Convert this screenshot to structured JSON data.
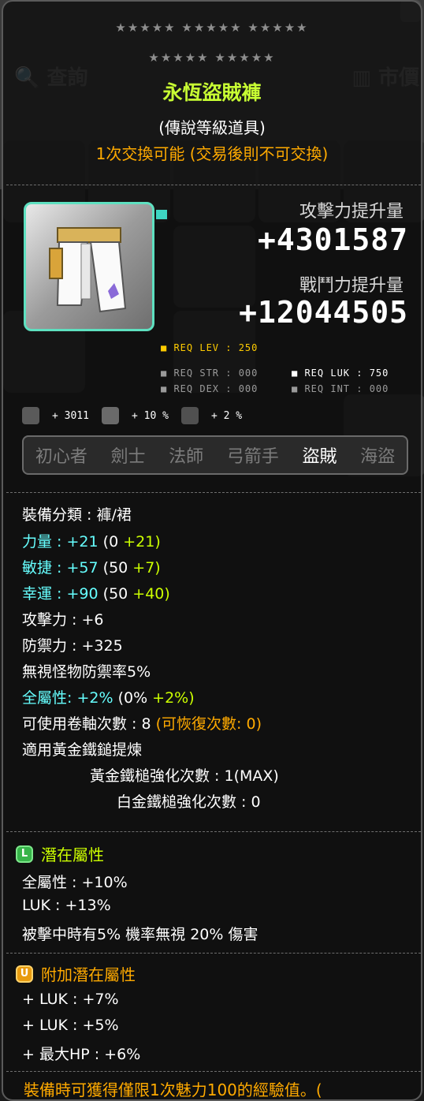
{
  "background": {
    "search_label": "查詢",
    "price_label": "市價"
  },
  "tooltip": {
    "stars_row1": "★★★★★ ★★★★★ ★★★★★",
    "stars_row2": "★★★★★ ★★★★★",
    "item_name": "永恆盜賊褲",
    "grade": "(傳說等級道具)",
    "trade_note": "1次交換可能 (交易後則不可交換)",
    "attack_increase_label": "攻擊力提升量",
    "attack_increase_value": "+4301587",
    "combat_increase_label": "戰鬥力提升量",
    "combat_increase_value": "+12044505",
    "req_lev": "■ REQ LEV : 250",
    "req_str": "■ REQ STR : 000",
    "req_luk": "■ REQ LUK : 750",
    "req_dex": "■ REQ DEX : 000",
    "req_int": "■ REQ INT : 000",
    "bonus_1": "+ 3011",
    "bonus_2": "+ 10 %",
    "bonus_3": "+ 2 %",
    "jobs": [
      "初心者",
      "劍士",
      "法師",
      "弓箭手",
      "盜賊",
      "海盜"
    ],
    "active_job_index": 4,
    "category": "裝備分類 : 褲/裙",
    "str_label": "力量 :",
    "str_total": "+21",
    "str_base": "(0",
    "str_bonus": "+21)",
    "dex_label": "敏捷 :",
    "dex_total": "+57",
    "dex_base": "(50",
    "dex_bonus": "+7)",
    "luk_label": "幸運 :",
    "luk_total": "+90",
    "luk_base": "(50",
    "luk_bonus": "+40)",
    "attack": "攻擊力 : +6",
    "defense": "防禦力 : +325",
    "ignore_def": "無視怪物防禦率5%",
    "all_stat_label": "全屬性:",
    "all_stat_total": "+2%",
    "all_stat_base": "(0%",
    "all_stat_bonus": "+2%)",
    "scroll_slots": "可使用卷軸次數 : 8",
    "scroll_recover": "(可恢復次數: 0)",
    "golden_hammer_applied": "適用黃金鐵鎚提煉",
    "golden_hammer_count": "黃金鐵槌強化次數 : 1(MAX)",
    "platinum_hammer_count": "白金鐵槌強化次數 : 0",
    "potential_title": "潛在屬性",
    "potential_icon": "L",
    "potential_lines": [
      "全屬性 : +10%",
      "LUK : +13%",
      "被擊中時有5% 機率無視 20% 傷害"
    ],
    "additional_title": "附加潛在屬性",
    "additional_icon": "U",
    "additional_lines": [
      "+ LUK : +7%",
      "+ LUK : +5%",
      "+ 最大HP : +6%"
    ],
    "footer": "裝備時可獲得僅限1次魅力100的經驗值。("
  },
  "colors": {
    "item_name": "#c8ff33",
    "trade": "#ffaa00",
    "stat_cyan": "#66ffff",
    "bonus_lime": "#ccff00"
  }
}
